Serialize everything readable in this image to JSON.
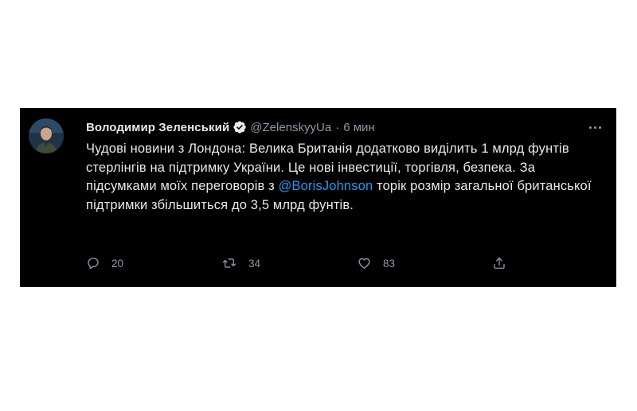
{
  "tweet": {
    "author": {
      "display_name": "Володимир Зеленський",
      "handle": "@ZelenskyyUa",
      "verified": true
    },
    "separator": "·",
    "timestamp": "6 мин",
    "text": {
      "before_mention": "Чудові новини з Лондона: Велика Британія додатково виділить 1 млрд фунтів стерлінгів на підтримку України. Це нові інвестиції, торгівля, безпека. За підсумками моїх переговорів з ",
      "mention": "@BorisJohnson",
      "after_mention": " торік розмір загальної британської підтримки збільшиться до 3,5 млрд фунтів."
    },
    "actions": {
      "reply_count": "20",
      "retweet_count": "34",
      "like_count": "83"
    }
  },
  "icons": {
    "avatar": "avatar-portrait",
    "verified": "verified-badge-icon",
    "more": "more-options-icon",
    "reply": "reply-icon",
    "retweet": "retweet-icon",
    "like": "heart-icon",
    "share": "share-icon"
  },
  "colors": {
    "card_background": "#000000",
    "page_background": "#ffffff",
    "text_primary": "#e7e9ea",
    "text_secondary": "#8b98a5",
    "link": "#1d9bf0"
  }
}
